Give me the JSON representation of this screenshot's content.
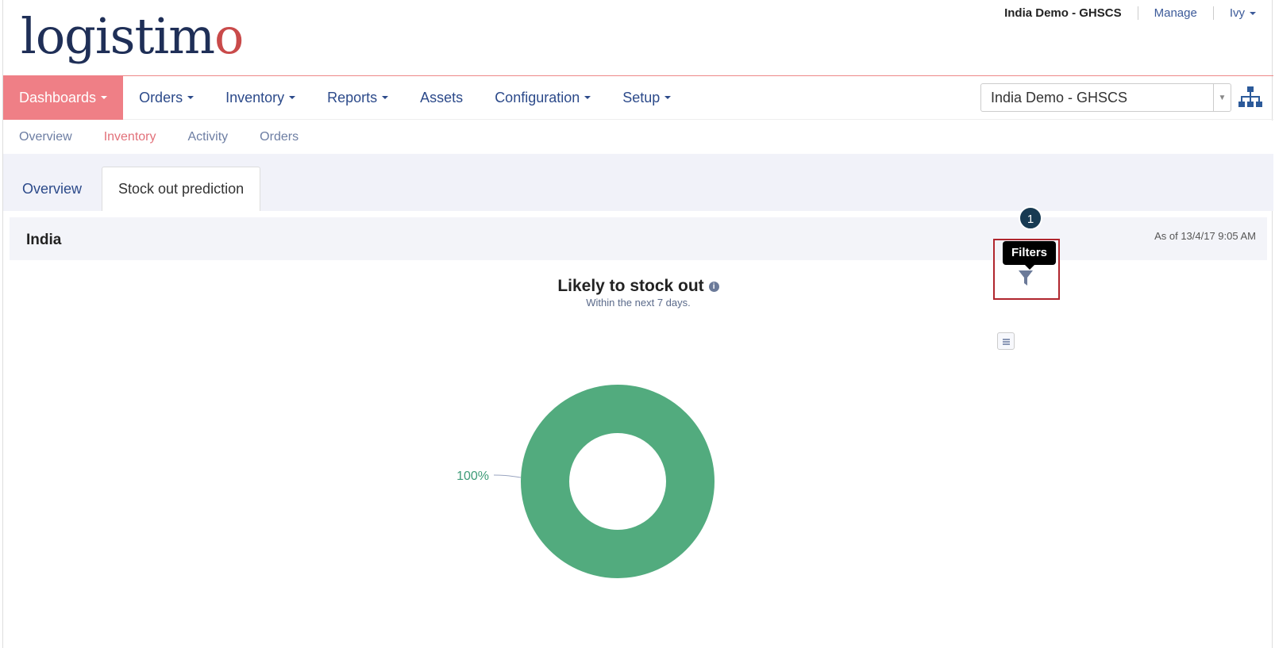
{
  "header": {
    "logo": {
      "part1": "lo",
      "part2": "gistim",
      "part3": "o"
    },
    "domain_name": "India Demo - GHSCS",
    "manage_label": "Manage",
    "user_label": "Ivy"
  },
  "nav": {
    "items": [
      {
        "label": "Dashboards",
        "dropdown": true,
        "active": true
      },
      {
        "label": "Orders",
        "dropdown": true
      },
      {
        "label": "Inventory",
        "dropdown": true
      },
      {
        "label": "Reports",
        "dropdown": true
      },
      {
        "label": "Assets",
        "dropdown": false
      },
      {
        "label": "Configuration",
        "dropdown": true
      },
      {
        "label": "Setup",
        "dropdown": true
      }
    ],
    "domain_select_value": "India Demo - GHSCS"
  },
  "subnav": {
    "items": [
      "Overview",
      "Inventory",
      "Activity",
      "Orders"
    ],
    "active": "Inventory"
  },
  "tabs": {
    "items": [
      "Overview",
      "Stock out prediction"
    ],
    "active": "Stock out prediction"
  },
  "panel": {
    "title": "India",
    "as_of": "As of 13/4/17 9:05 AM",
    "tooltip": "Filters",
    "callout_number": "1"
  },
  "chart_data": {
    "type": "pie",
    "title": "Likely to stock out",
    "subtitle": "Within the next 7 days.",
    "donut": true,
    "slices": [
      {
        "value": 100,
        "label": "100%",
        "color": "#52ab7e"
      }
    ]
  },
  "colors": {
    "accent": "#ef7f86",
    "nav_text": "#2c4a8a",
    "callout_border": "#b0262e"
  }
}
